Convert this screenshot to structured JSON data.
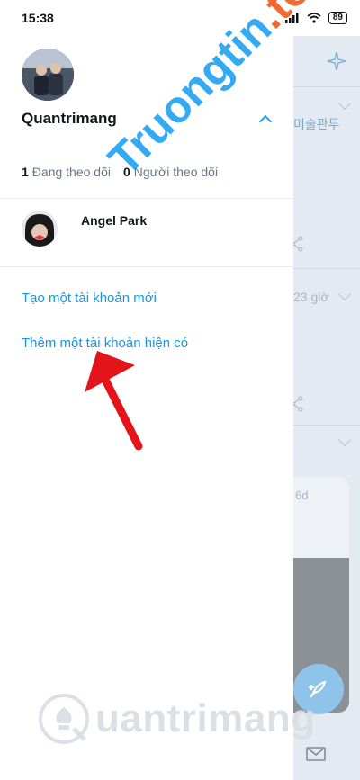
{
  "status_bar": {
    "time": "15:38",
    "battery": "89"
  },
  "drawer": {
    "username": "Quantrimang",
    "following_count": "1",
    "following_label": "Đang theo dõi",
    "followers_count": "0",
    "followers_label": "Người theo dõi",
    "other_account": {
      "name": "Angel Park"
    },
    "links": [
      {
        "label": "Tạo một tài khoản mới"
      },
      {
        "label": "Thêm một tài khoản hiện có"
      }
    ]
  },
  "background_app": {
    "korean_text": "미술관투",
    "time_ago": "23 giờ",
    "age": "6d"
  },
  "watermarks": {
    "top_main": "Truongtin",
    "top_accent": ".top",
    "bottom": "uantrimang"
  },
  "colors": {
    "accent": "#1da1f2",
    "link": "#1b95e0",
    "annotation": "#e3151b"
  }
}
